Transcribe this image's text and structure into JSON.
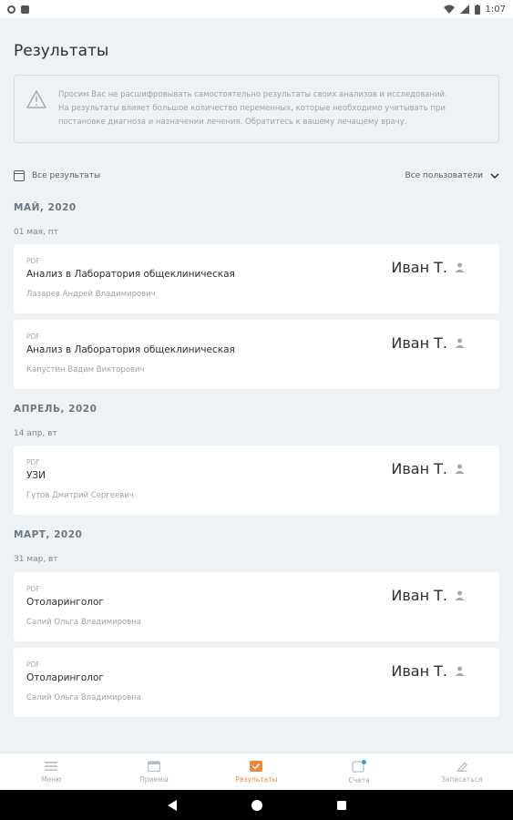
{
  "status_bar": {
    "time": "1:07"
  },
  "page": {
    "title": "Результаты"
  },
  "notice": {
    "line1": "Просим Вас не расшифровывать самостоятельно результаты своих анализов и исследований.",
    "line2": "На результаты влияет большое количество переменных, которые необходимо учитывать при",
    "line3": "постановке диагноза и назначении лечения. Обратитесь к вашему лечащему врачу."
  },
  "filters": {
    "left_label": "Все результаты",
    "right_label": "Все пользователи"
  },
  "sections": [
    {
      "month": "МАЙ, 2020",
      "days": [
        {
          "day": "01 мая, пт",
          "cards": [
            {
              "type": "PDF",
              "title": "Анализ в Лаборатория общеклиническая",
              "doctor": "Лазарев Андрей Владимирович",
              "user": "Иван Т."
            },
            {
              "type": "PDF",
              "title": "Анализ в Лаборатория общеклиническая",
              "doctor": "Капустин Вадим Викторович",
              "user": "Иван Т."
            }
          ]
        }
      ]
    },
    {
      "month": "АПРЕЛЬ, 2020",
      "days": [
        {
          "day": "14 апр, вт",
          "cards": [
            {
              "type": "PDF",
              "title": "УЗИ",
              "doctor": "Гутов Дмитрий Сергеевич",
              "user": "Иван Т."
            }
          ]
        }
      ]
    },
    {
      "month": "МАРТ, 2020",
      "days": [
        {
          "day": "31 мар, вт",
          "cards": [
            {
              "type": "PDF",
              "title": "Отоларинголог",
              "doctor": "Салий Ольга Владимировна",
              "user": "Иван Т."
            },
            {
              "type": "PDF",
              "title": "Отоларинголог",
              "doctor": "Салий Ольга Владимировна",
              "user": "Иван Т."
            }
          ]
        }
      ]
    }
  ],
  "bottom_nav": {
    "items": [
      {
        "label": "Меню",
        "icon": "menu-icon"
      },
      {
        "label": "Приемы",
        "icon": "appointments-icon"
      },
      {
        "label": "Результаты",
        "icon": "results-icon",
        "active": true
      },
      {
        "label": "Счета",
        "icon": "bills-icon"
      },
      {
        "label": "Записаться",
        "icon": "edit-icon"
      }
    ]
  },
  "colors": {
    "accent": "#f0873a",
    "background": "#eef2f5",
    "card": "#ffffff",
    "badge": "#2aa0e0"
  }
}
